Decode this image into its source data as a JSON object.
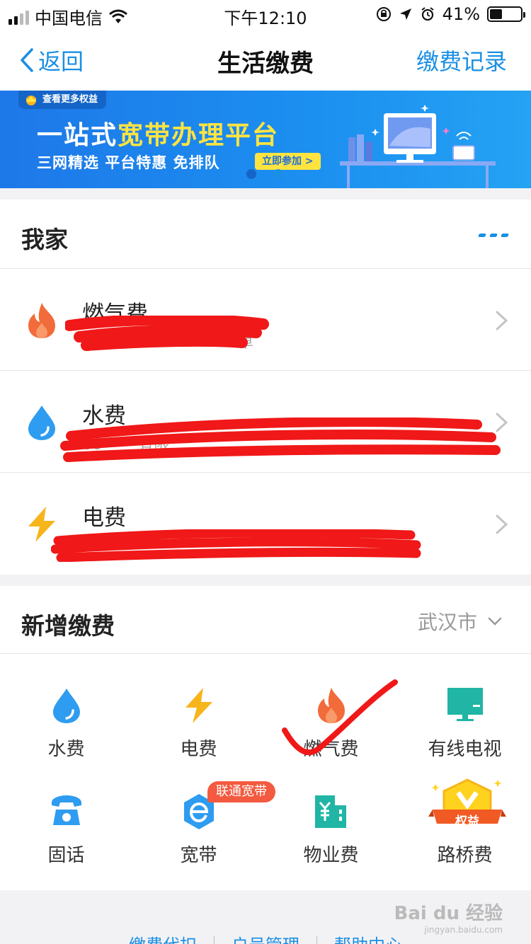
{
  "status_bar": {
    "carrier": "中国电信",
    "time": "下午12:10",
    "battery": "41%",
    "battery_level": 0.41
  },
  "nav": {
    "back_label": "返回",
    "title": "生活缴费",
    "record_label": "缴费记录"
  },
  "banner": {
    "tag": "查看更多权益",
    "title_prefix": "一站式",
    "title_highlight": "宽带办理平台",
    "subtitle": "三网精选  平台特惠  免排队",
    "button_label": "立即参加 >",
    "page_count": 2,
    "active_page": 2
  },
  "my_home": {
    "title": "我家",
    "bills": [
      {
        "name": "燃气费",
        "icon": "flame-icon",
        "sub": "卓"
      },
      {
        "name": "水费",
        "icon": "water-drop-icon",
        "sub": "06**** 有限"
      },
      {
        "name": "电费",
        "icon": "lightning-icon",
        "sub": ""
      }
    ]
  },
  "new_payment": {
    "title": "新增缴费",
    "city": "武汉市",
    "items": [
      {
        "label": "水费",
        "icon": "water-drop-icon"
      },
      {
        "label": "电费",
        "icon": "lightning-icon"
      },
      {
        "label": "燃气费",
        "icon": "flame-icon"
      },
      {
        "label": "有线电视",
        "icon": "tv-icon"
      },
      {
        "label": "固话",
        "icon": "phone-icon"
      },
      {
        "label": "宽带",
        "icon": "broadband-icon"
      },
      {
        "label": "物业费",
        "icon": "building-icon"
      },
      {
        "label": "路桥费",
        "icon": "road-bridge-icon"
      }
    ],
    "promo_badge": "联通宽带",
    "rights_badge": "权益"
  },
  "footer": {
    "links": [
      "缴费代扣",
      "户号管理",
      "帮助中心"
    ]
  },
  "watermark": {
    "brand": "Bai du 经验",
    "url": "jingyan.baidu.com"
  },
  "colors": {
    "accent": "#1a8fe3",
    "flame": "#f26b3a",
    "water": "#2e9cf0",
    "lightning": "#f7b51c",
    "tv": "#20b5a5",
    "annotation_red": "#f01818"
  }
}
